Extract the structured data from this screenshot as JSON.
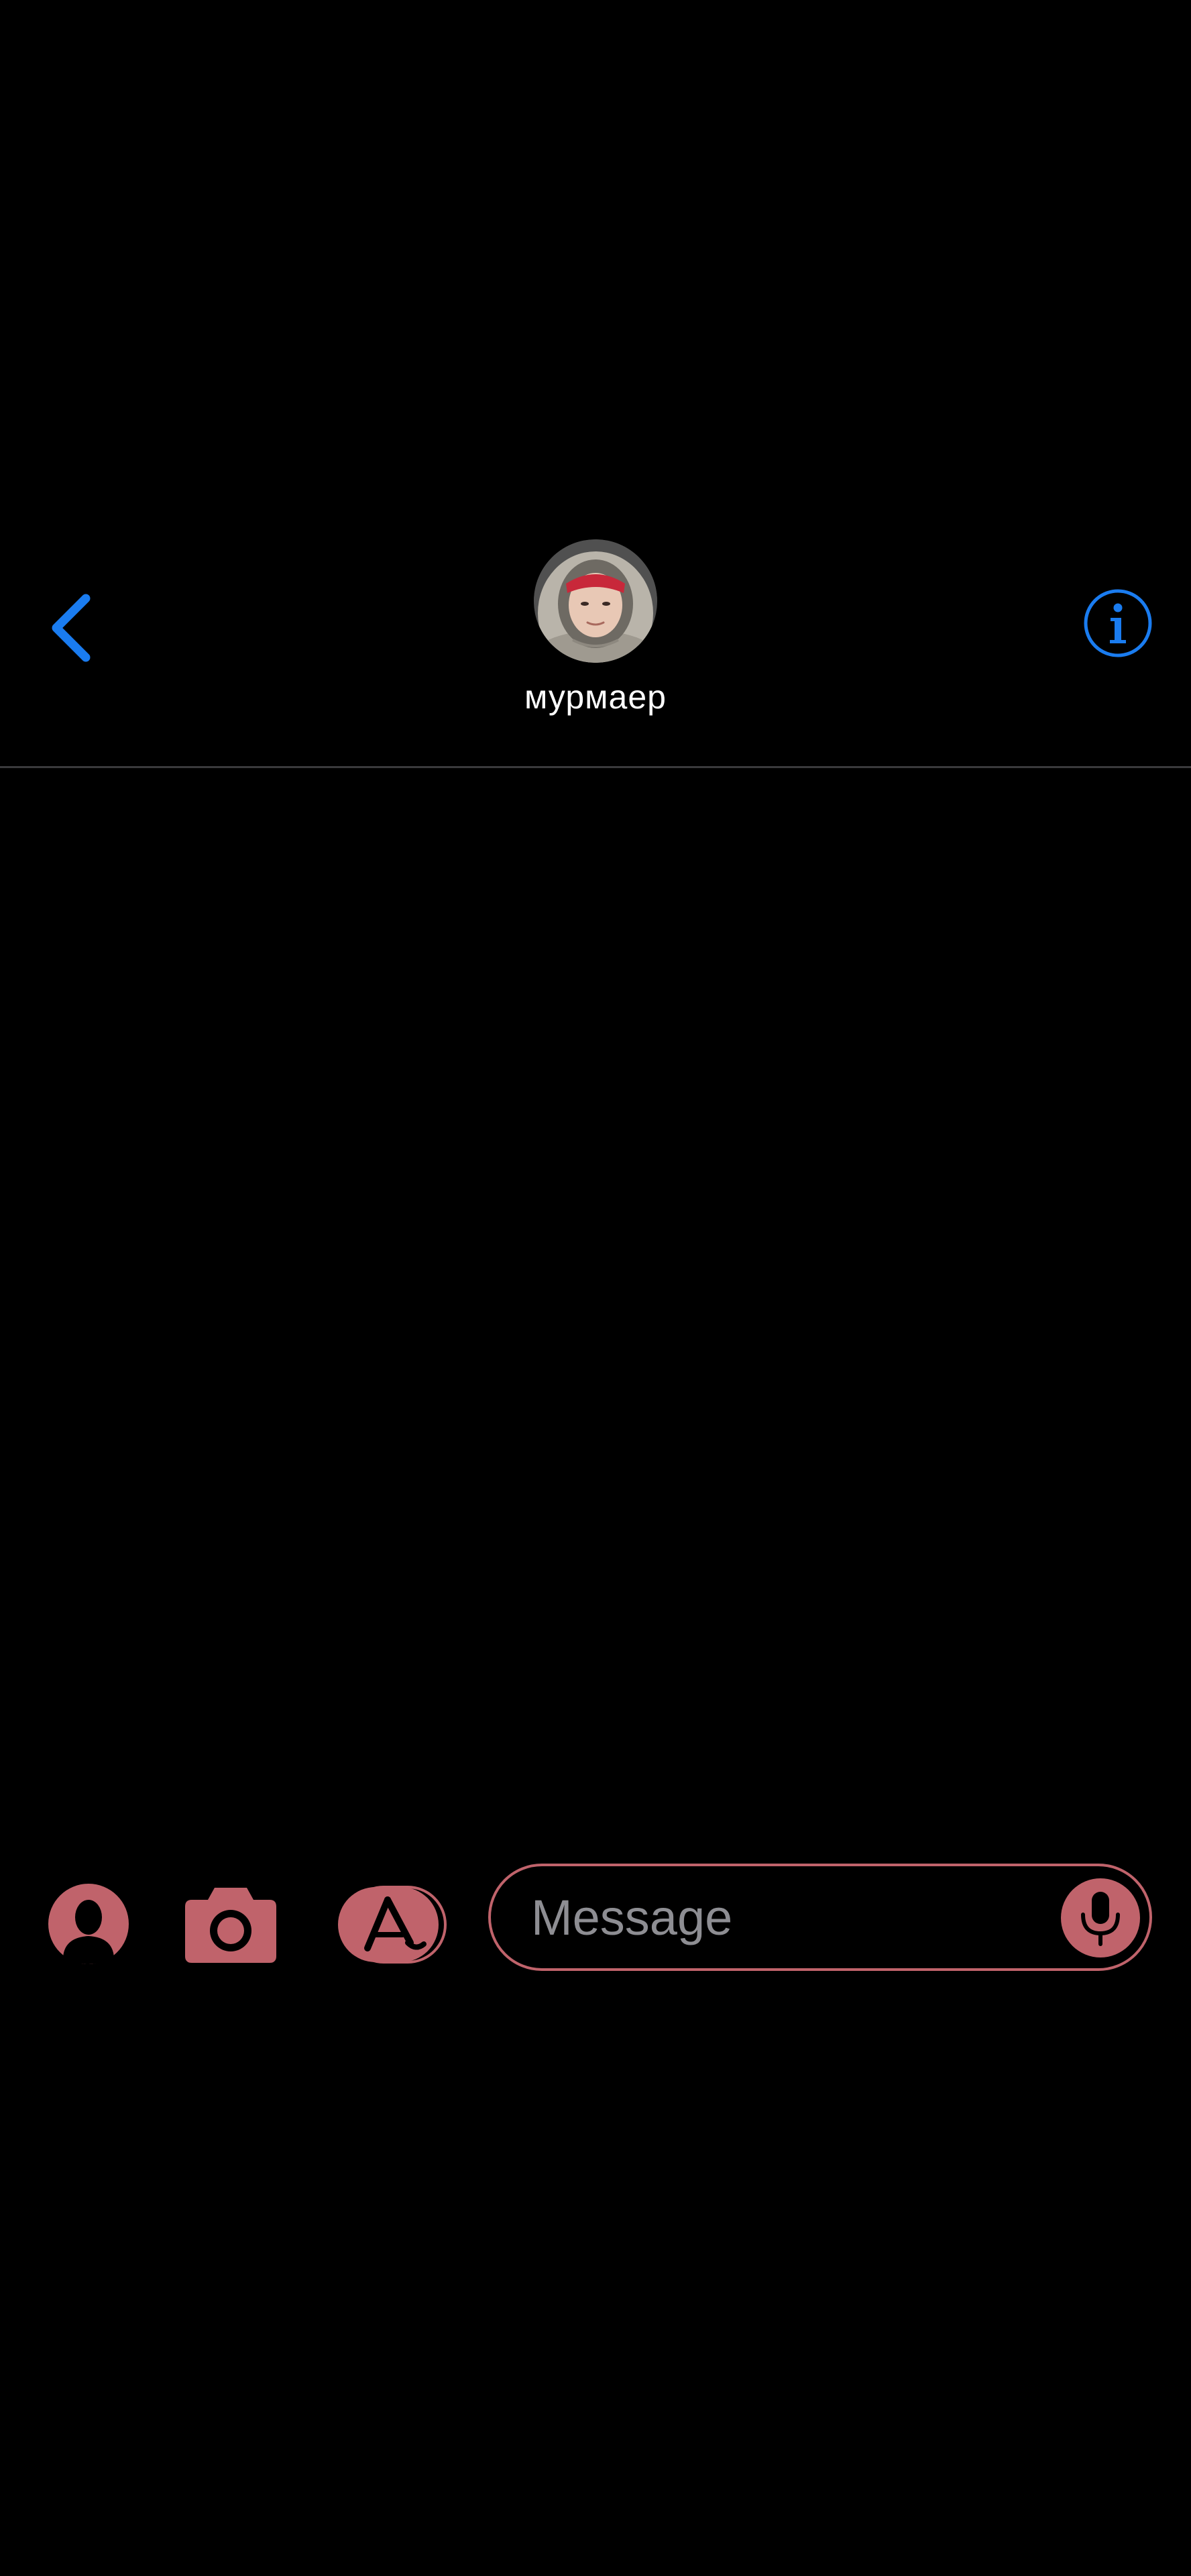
{
  "header": {
    "back_icon": "chevron-left-icon",
    "info_icon": "info-circle-icon",
    "contact_name": "мурмаер",
    "avatar": "contact-avatar-photo"
  },
  "input_bar": {
    "memoji_icon": "memoji-icon",
    "camera_icon": "camera-icon",
    "apps_icon": "app-store-icon",
    "message_placeholder": "Message",
    "message_value": "",
    "mic_icon": "microphone-icon"
  },
  "colors": {
    "background": "#000000",
    "accent_blue": "#1a7cf0",
    "input_accent": "#c0636b",
    "divider": "#3a3a3c",
    "placeholder": "#8e8e93",
    "text": "#ffffff"
  }
}
